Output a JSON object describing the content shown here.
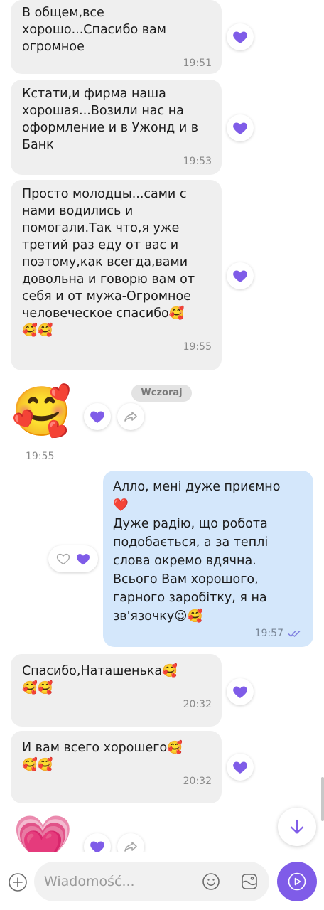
{
  "colors": {
    "accent": "#7f5ce8",
    "incoming_bubble": "#efefef",
    "outgoing_bubble": "#d4e7fb",
    "read_ticks": "#7f7fe0"
  },
  "messages": [
    {
      "text": "В общем,все\nхорошо...Спасибо вам\nогромное",
      "time": "19:51"
    },
    {
      "text": "Кстати,и фирма наша\nхорошая...Возили нас на\nоформление и в Ужонд и в\nБанк",
      "time": "19:53"
    },
    {
      "text": "Просто молодцы...сами с\nнами водились и\nпомогали.Так что,я уже\nтретий раз еду от вас и\nпоэтому,как всегда,вами\nдовольна и говорю вам от\nсебя и от мужа-Огромное\nчеловеческое спасибо🥰\n🥰🥰",
      "time": "19:55"
    }
  ],
  "sticker1": {
    "emoji": "🥰",
    "time": "19:55"
  },
  "date_divider": "Wczoraj",
  "outgoing": {
    "text": "Алло, мені дуже приємно\n❤️\nДуже радію, що робота\nподобається, а за теплі\nслова окремо вдячна.\nВсього Вам хорошого,\nгарного заробітку, я на\nзв'язочку😉🥰",
    "time": "19:57"
  },
  "messages2": [
    {
      "text": "Спасибо,Наташенька🥰\n🥰🥰",
      "time": "20:32"
    },
    {
      "text": "И вам всего хорошего🥰\n🥰🥰",
      "time": "20:32"
    }
  ],
  "sticker2": {
    "emoji": "💗"
  },
  "composer": {
    "placeholder": "Wiadomość..."
  },
  "icons": {
    "like": "heart-filled-icon",
    "like_empty": "heart-outline-icon",
    "forward": "forward-icon",
    "add": "plus-circle-icon",
    "emoji": "smiley-icon",
    "sticker": "sticker-icon",
    "send": "send-icon",
    "scroll_down": "arrow-down-icon",
    "read": "double-check-icon"
  }
}
